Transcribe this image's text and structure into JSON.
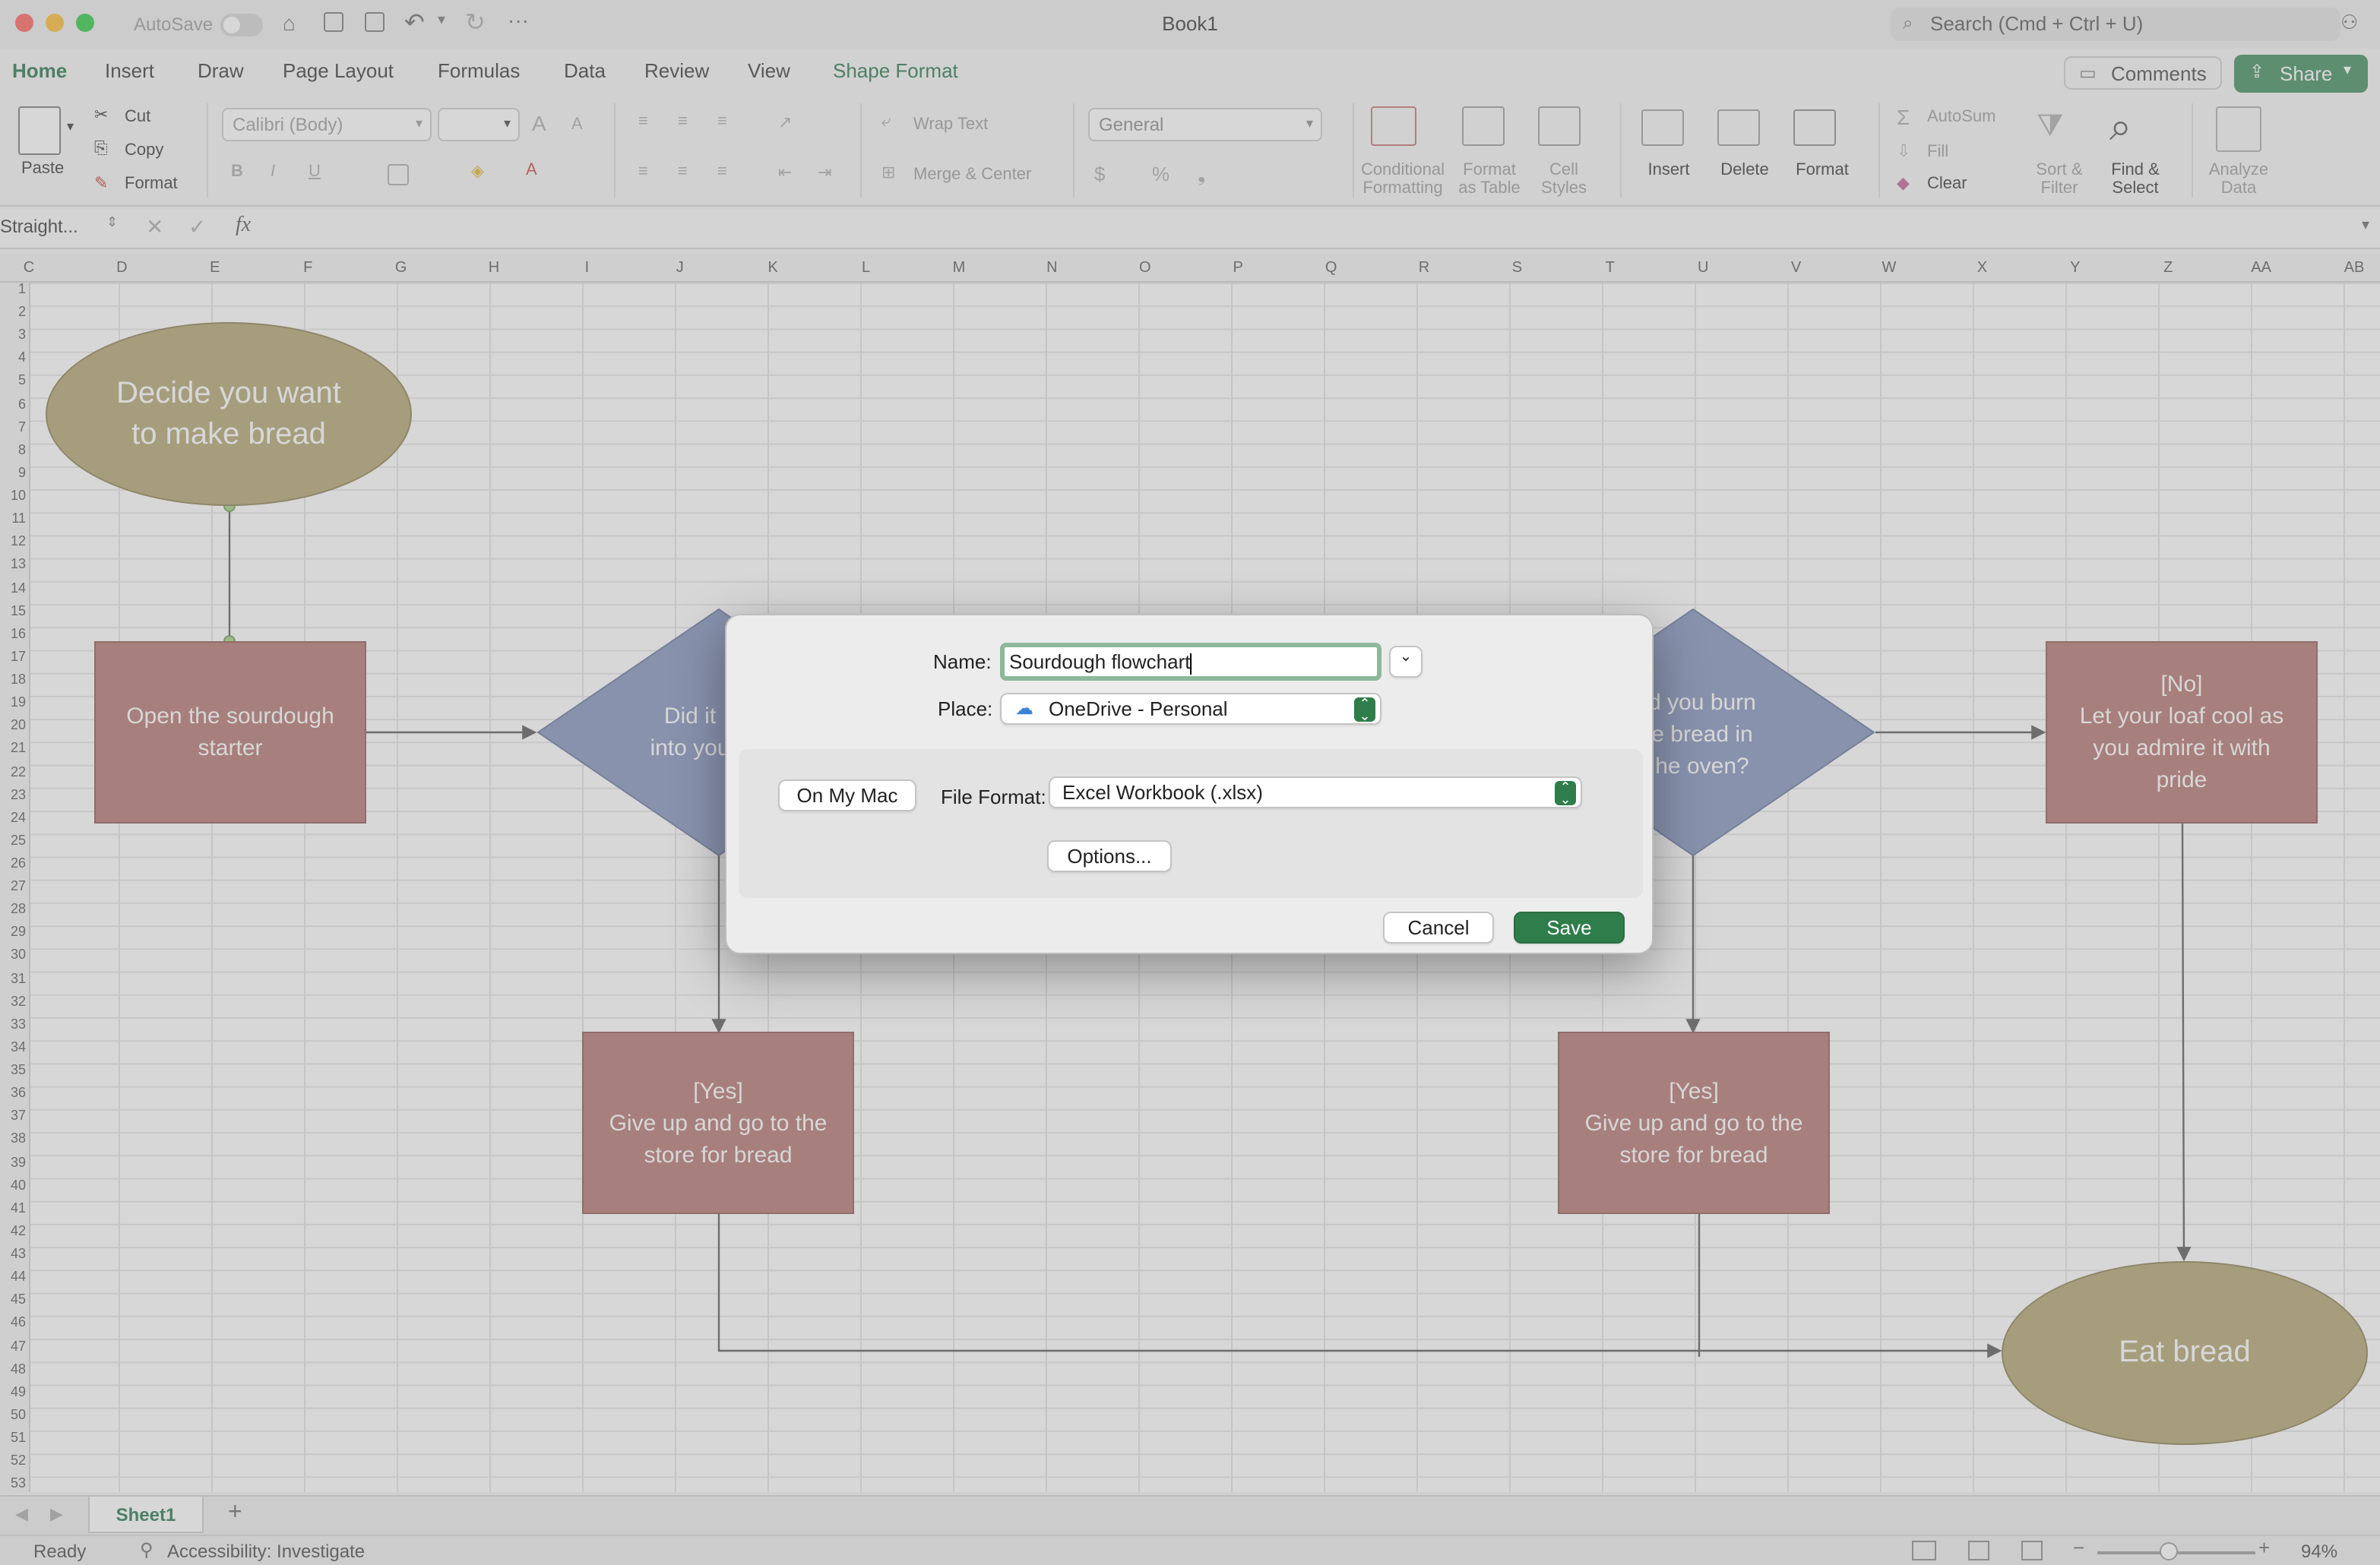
{
  "window": {
    "title": "Book1",
    "autosave_label": "AutoSave",
    "search_placeholder": "Search (Cmd + Ctrl + U)"
  },
  "ribbon_tabs": [
    "Home",
    "Insert",
    "Draw",
    "Page Layout",
    "Formulas",
    "Data",
    "Review",
    "View",
    "Shape Format"
  ],
  "active_tab": "Home",
  "header_buttons": {
    "comments": "Comments",
    "share": "Share"
  },
  "ribbon": {
    "paste": "Paste",
    "cut": "Cut",
    "copy": "Copy",
    "format_painter": "Format",
    "font_name": "Calibri (Body)",
    "font_size": "",
    "wrap_text": "Wrap Text",
    "merge_center": "Merge & Center",
    "number_format": "General",
    "conditional_formatting": "Conditional\nFormatting",
    "format_as_table": "Format\nas Table",
    "cell_styles": "Cell\nStyles",
    "insert": "Insert",
    "delete": "Delete",
    "format": "Format",
    "autosum": "AutoSum",
    "fill": "Fill",
    "clear": "Clear",
    "sort_filter": "Sort &\nFilter",
    "find_select": "Find &\nSelect",
    "analyze_data": "Analyze\nData"
  },
  "formula_bar": {
    "name_box": "Straight...",
    "fx": "fx",
    "content": ""
  },
  "columns": [
    "C",
    "D",
    "E",
    "F",
    "G",
    "H",
    "I",
    "J",
    "K",
    "L",
    "M",
    "N",
    "O",
    "P",
    "Q",
    "R",
    "S",
    "T",
    "U",
    "V",
    "W",
    "X",
    "Y",
    "Z",
    "AA",
    "AB"
  ],
  "rows": [
    1,
    2,
    3,
    4,
    5,
    6,
    7,
    8,
    9,
    10,
    11,
    12,
    13,
    14,
    15,
    16,
    17,
    18,
    19,
    20,
    21,
    22,
    23,
    24,
    25,
    26,
    27,
    28,
    29,
    30,
    31,
    32,
    33,
    34,
    35,
    36,
    37,
    38,
    39,
    40,
    41,
    42,
    43,
    44,
    45,
    46,
    47,
    48,
    49,
    50,
    51,
    52,
    53
  ],
  "flowchart": {
    "start": "Decide you want\nto make bread",
    "step1": "Open the sourdough\nstarter",
    "decision1_visible": "Did it\ninto you",
    "decision2_visible": "d you burn\ne bread in\nhe oven?",
    "no_box": "[No]\nLet your loaf cool as\nyou admire it with\npride",
    "yes_box_1": "[Yes]\nGive up and go to the\nstore for bread",
    "yes_box_2": "[Yes]\nGive up and go to the\nstore for bread",
    "end": "Eat bread"
  },
  "sheet_tabs": [
    "Sheet1"
  ],
  "status": {
    "ready": "Ready",
    "accessibility": "Accessibility: Investigate",
    "zoom": "94%"
  },
  "save_dialog": {
    "name_label": "Name:",
    "name_value": "Sourdough flowchart",
    "place_label": "Place:",
    "place_value": "OneDrive - Personal",
    "on_my_mac": "On My Mac",
    "file_format_label": "File Format:",
    "file_format_value": "Excel Workbook (.xlsx)",
    "options": "Options...",
    "cancel": "Cancel",
    "save": "Save"
  },
  "colors": {
    "accent": "#217346",
    "save_button": "#2f7d4a",
    "oval": "#b1a26e",
    "box": "#b2716c",
    "diamond": "#8090bb"
  }
}
